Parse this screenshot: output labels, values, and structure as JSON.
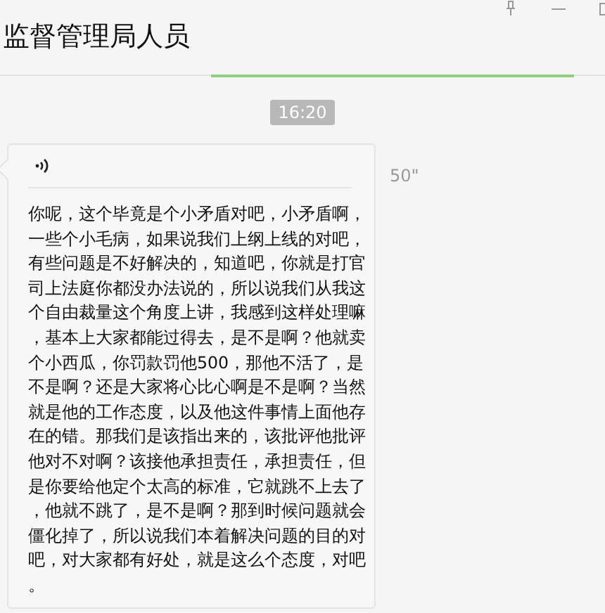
{
  "window": {
    "title": "监督管理局人员"
  },
  "timestamp": "16:20",
  "message": {
    "kind": "voice",
    "duration": "50\"",
    "transcript": "你呢，这个毕竟是个小矛盾对吧，小矛盾啊，一些个小毛病，如果说我们上纲上线的对吧，有些问题是不好解决的，知道吧，你就是打官司上法庭你都没办法说的，所以说我们从我这个自由裁量这个角度上讲，我感到这样处理嘛，基本上大家都能过得去，是不是啊？他就卖个小西瓜，你罚款罚他500，那他不活了，是不是啊？还是大家将心比心啊是不是啊？当然就是他的工作态度，以及他这件事情上面他存在的错。那我们是该指出来的，该批评他批评他对不对啊？该接他承担责任，承担责任，但是你要给他定个太高的标准，它就跳不上去了，他就不跳了，是不是啊？那到时候问题就会僵化掉了，所以说我们本着解决问题的目的对吧，对大家都有好处，就是这么个态度，对吧。"
  }
}
